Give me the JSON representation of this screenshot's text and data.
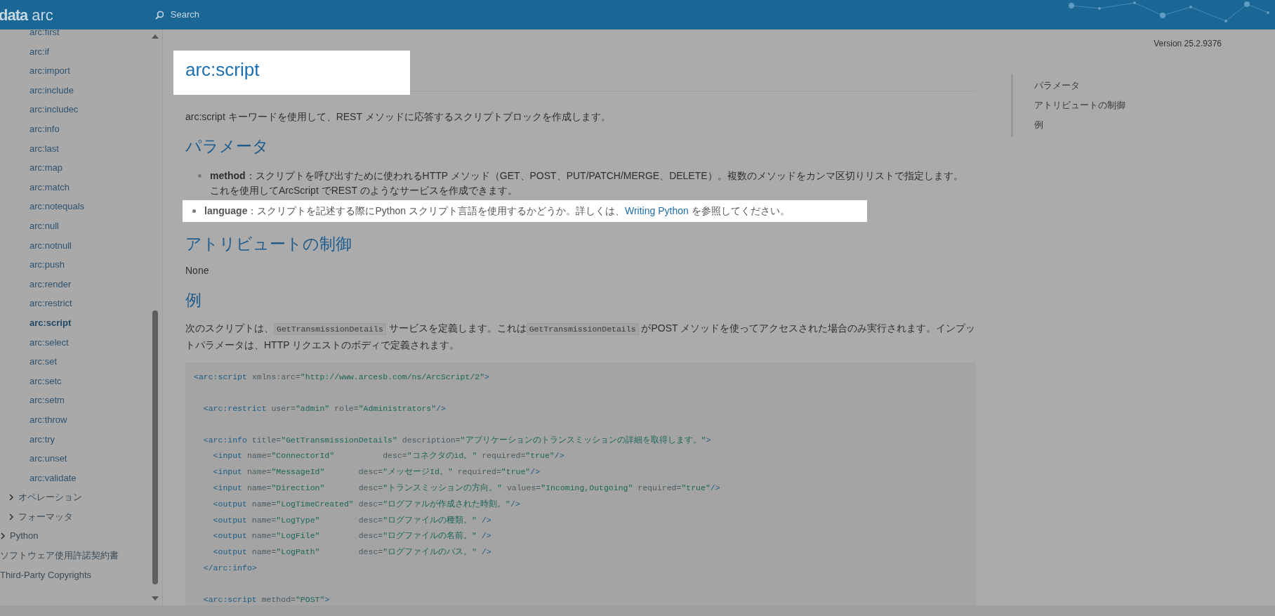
{
  "header": {
    "logo_mark": "data",
    "logo_text": "arc",
    "search": {
      "placeholder": "Search"
    }
  },
  "sidebar": {
    "items": [
      {
        "children": [
          {
            "children": [
              {
                "label": "arc:first",
                "selected": false
              },
              {
                "label": "arc:if",
                "selected": false
              },
              {
                "label": "arc:import",
                "selected": false
              },
              {
                "label": "arc:include",
                "selected": false
              },
              {
                "label": "arc:includec",
                "selected": false
              },
              {
                "label": "arc:info",
                "selected": false
              },
              {
                "label": "arc:last",
                "selected": false
              },
              {
                "label": "arc:map",
                "selected": false
              },
              {
                "label": "arc:match",
                "selected": false
              },
              {
                "label": "arc:notequals",
                "selected": false
              },
              {
                "label": "arc:null",
                "selected": false
              },
              {
                "label": "arc:notnull",
                "selected": false
              },
              {
                "label": "arc:push",
                "selected": false
              },
              {
                "label": "arc:render",
                "selected": false
              },
              {
                "label": "arc:restrict",
                "selected": false
              },
              {
                "label": "arc:script",
                "selected": true
              },
              {
                "label": "arc:select",
                "selected": false
              },
              {
                "label": "arc:set",
                "selected": false
              },
              {
                "label": "arc:setc",
                "selected": false
              },
              {
                "label": "arc:setm",
                "selected": false
              },
              {
                "label": "arc:throw",
                "selected": false
              },
              {
                "label": "arc:try",
                "selected": false
              },
              {
                "label": "arc:unset",
                "selected": false
              },
              {
                "label": "arc:validate",
                "selected": false
              }
            ]
          },
          {
            "label": "オペレーション",
            "expanded": false
          },
          {
            "label": "フォーマッタ",
            "expanded": false
          }
        ]
      },
      {
        "label": "Python",
        "expanded": false
      },
      {
        "label": "ソフトウェア使用許諾契約書"
      },
      {
        "label": "Third-Party Copyrights"
      }
    ]
  },
  "article": {
    "title": "arc:script",
    "title_highlighted": true,
    "intro": "arc:script キーワードを使用して、REST メソッドに応答するスクリプトブロックを作成します。",
    "sections": [
      {
        "kind": "bullets",
        "heading": "パラメータ",
        "items": [
          {
            "text": "**method**：スクリプトを呼び出すために使われるHTTP メソッド（GET、POST、PUT/PATCH/MERGE、DELETE）。複数のメソッドをカンマ区切りリストで指定します。これを使用してArcScript でREST のようなサービスを作成できます。",
            "highlighted": false
          },
          {
            "text": "**language**：スクリプトを記述する際にPython スクリプト言語を使用するかどうか。詳しくは、",
            "link": "Writing Python",
            "after": " を参照してください。",
            "highlighted": true
          }
        ]
      },
      {
        "kind": "text",
        "heading": "アトリビュートの制御",
        "text": "None"
      },
      {
        "kind": "example",
        "heading": "例",
        "paragraph": [
          {
            "kind": "text",
            "text": "次のスクリプトは、"
          },
          {
            "kind": "code",
            "text": "GetTransmissionDetails"
          },
          {
            "kind": "text",
            "text": " サービスを定義します。これは"
          },
          {
            "kind": "code",
            "text": "GetTransmissionDetails"
          },
          {
            "kind": "text",
            "text": " がPOST メソッドを使ってアクセスされた場合のみ実行されます。インプットパラメータは、HTTP リクエストのボディで定義されます。"
          }
        ],
        "code_blocks": [
          [
            "<arc:script xmlns:arc=\"http://www.arcesb.com/ns/ArcScript/2\">"
          ],
          [
            "  <arc:restrict user=\"admin\" role=\"Administrators\"/>"
          ],
          [
            "  <arc:info title=\"GetTransmissionDetails\" description=\"アプリケーションのトランスミッションの詳細を取得します。\">",
            "    <input name=\"ConnectorId\"          desc=\"コネクタのid。\" required=\"true\"/>",
            "    <input name=\"MessageId\"       desc=\"メッセージId。\" required=\"true\"/>",
            "    <input name=\"Direction\"       desc=\"トランスミッションの方向。\" values=\"Incoming,Outgoing\" required=\"true\"/>",
            "    <output name=\"LogTimeCreated\" desc=\"ログファルが作成された時刻。\"/>",
            "    <output name=\"LogType\"        desc=\"ログファイルの種類。\" />",
            "    <output name=\"LogFile\"        desc=\"ログファイルの名前。\" />",
            "    <output name=\"LogPath\"        desc=\"ログファイルのパス。\" />",
            "  </arc:info>"
          ],
          [
            "  <arc:script method=\"POST\">"
          ]
        ]
      }
    ]
  },
  "toc": {
    "version": "Version 25.2.9376",
    "items": [
      "パラメータ",
      "アトリビュートの制御",
      "例"
    ]
  }
}
